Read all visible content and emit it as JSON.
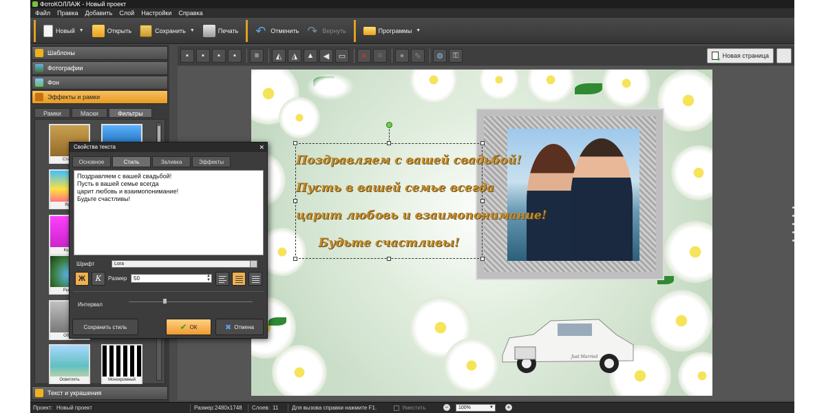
{
  "window": {
    "title": "ФотоКОЛЛАЖ - Новый проект"
  },
  "menubar": {
    "items": [
      "Файл",
      "Правка",
      "Добавить",
      "Слой",
      "Настройки",
      "Справка"
    ]
  },
  "toolbar": {
    "new_label": "Новый",
    "open_label": "Открыть",
    "save_label": "Сохранить",
    "print_label": "Печать",
    "undo_label": "Отменить",
    "redo_label": "Вернуть",
    "programs_label": "Программы"
  },
  "sidebar": {
    "sections": [
      "Шаблоны",
      "Фотографии",
      "Фон",
      "Эффекты и рамки",
      "Текст и украшения"
    ],
    "active_section": "Эффекты и рамки",
    "subtabs": [
      "Рамки",
      "Маски",
      "Фильтры"
    ],
    "active_subtab": "Фильтры",
    "thumbnails": [
      "Старин",
      "Ярко",
      "Колор",
      "Рыбий",
      "Обесц",
      "Осветлить",
      "Монохромный"
    ]
  },
  "page_toolbar": {
    "new_page_label": "Новая страница"
  },
  "canvas": {
    "text_lines": [
      "Поздравляем с вашей свадьбой!",
      "Пусть в вашей семье всегда",
      "царит любовь и взаимопонимание!",
      "Будьте счастливы!"
    ],
    "car_plate": "Just Married"
  },
  "dialog": {
    "title": "Свойства текста",
    "tabs": [
      "Основное",
      "Стиль",
      "Заливка",
      "Эффекты"
    ],
    "active_tab": "Стиль",
    "text_lines": [
      "Поздравляем с вашей свадьбой!",
      "Пусть в вашей семье всегда",
      "царит любовь и взаимопонимание!",
      "Будьте счастливы!"
    ],
    "font_label": "Шрифт",
    "font_value": "Lora",
    "bold_label": "Ж",
    "italic_label": "К",
    "size_label": "Размер",
    "size_value": "50",
    "interval_label": "Интервал",
    "save_style_label": "Сохранить стиль",
    "ok_label": "ОК",
    "cancel_label": "Отмена"
  },
  "statusbar": {
    "project_label": "Проект:",
    "project_value": "Новый проект",
    "size_label": "Размер:",
    "size_value": "2480x1748",
    "layers_label": "Слоев:",
    "layers_value": "11",
    "help_text": "Для вызова справки нажмите F1.",
    "fit_label": "Уместить",
    "zoom_value": "100%"
  },
  "colors": {
    "accent_orange": "#e89a20",
    "text_gold": "#c08a2a",
    "status_dark": "#2a2a2a"
  }
}
